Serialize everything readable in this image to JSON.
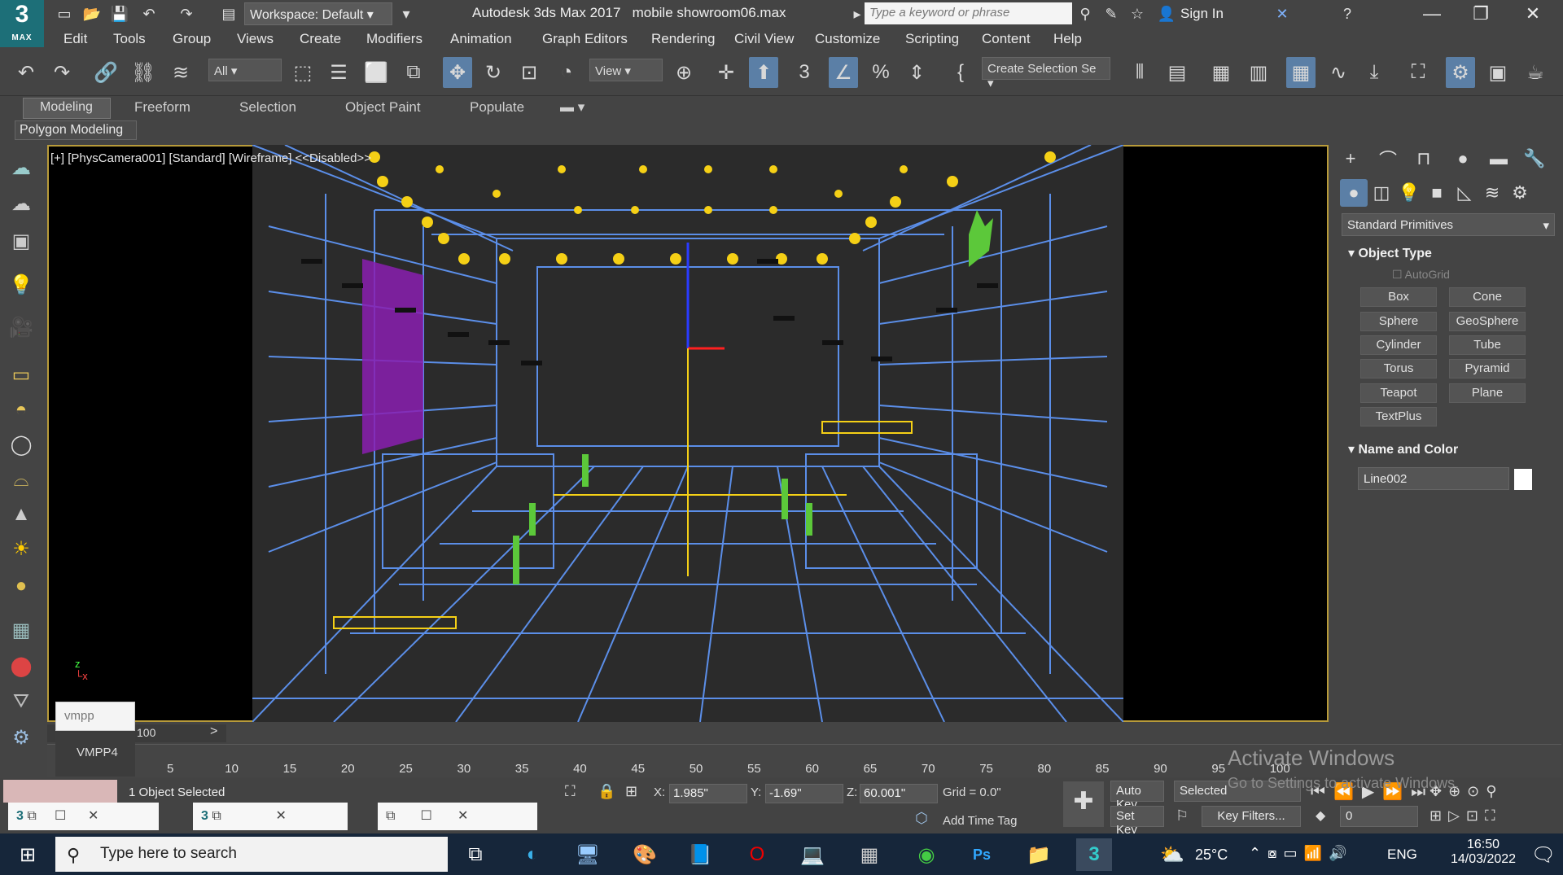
{
  "app": {
    "logo_number": "3",
    "logo_text": "MAX",
    "workspace": "Workspace: Default",
    "title": "Autodesk 3ds Max 2017",
    "file": "mobile showroom06.max",
    "search_placeholder": "Type a keyword or phrase",
    "signin": "Sign In"
  },
  "menu": [
    "Edit",
    "Tools",
    "Group",
    "Views",
    "Create",
    "Modifiers",
    "Animation",
    "Graph Editors",
    "Rendering",
    "Civil View",
    "Customize",
    "Scripting",
    "Content",
    "Help"
  ],
  "toolbar": {
    "selection_filter": "All",
    "ref_coord": "View",
    "selection_set": "Create Selection Se"
  },
  "ribbon": {
    "tabs": [
      "Modeling",
      "Freeform",
      "Selection",
      "Object Paint",
      "Populate"
    ],
    "panel": "Polygon Modeling"
  },
  "viewport": {
    "label": "[+] [PhysCamera001] [Standard] [Wireframe] <<Disabled>>"
  },
  "command_panel": {
    "category": "Standard Primitives",
    "object_type_title": "Object Type",
    "autogrid": "AutoGrid",
    "buttons": [
      "Box",
      "Cone",
      "Sphere",
      "GeoSphere",
      "Cylinder",
      "Tube",
      "Torus",
      "Pyramid",
      "Teapot",
      "Plane",
      "TextPlus"
    ],
    "name_color_title": "Name and Color",
    "object_name": "Line002",
    "object_color": "#ffffff"
  },
  "timeline": {
    "frame_display": "100",
    "ticks": [
      "5",
      "10",
      "15",
      "20",
      "25",
      "30",
      "35",
      "40",
      "45",
      "50",
      "55",
      "60",
      "65",
      "70",
      "75",
      "80",
      "85",
      "90",
      "95",
      "100"
    ]
  },
  "popup": {
    "input": "vmpp",
    "item": "VMPP4"
  },
  "status": {
    "selected": "1 Object Selected",
    "x_label": "X:",
    "x": "1.985\"",
    "y_label": "Y:",
    "y": "-1.69\"",
    "z_label": "Z:",
    "z": "60.001\"",
    "grid": "Grid = 0.0\"",
    "add_time_tag": "Add Time Tag",
    "auto_key": "Auto Key",
    "selected_filter": "Selected",
    "set_key": "Set Key",
    "key_filters": "Key Filters...",
    "frame": "0"
  },
  "watermark": {
    "line1": "Activate Windows",
    "line2": "Go to Settings to activate Windows."
  },
  "taskbar": {
    "search": "Type here to search",
    "temp": "25°C",
    "lang": "ENG",
    "time": "16:50",
    "date": "14/03/2022"
  }
}
